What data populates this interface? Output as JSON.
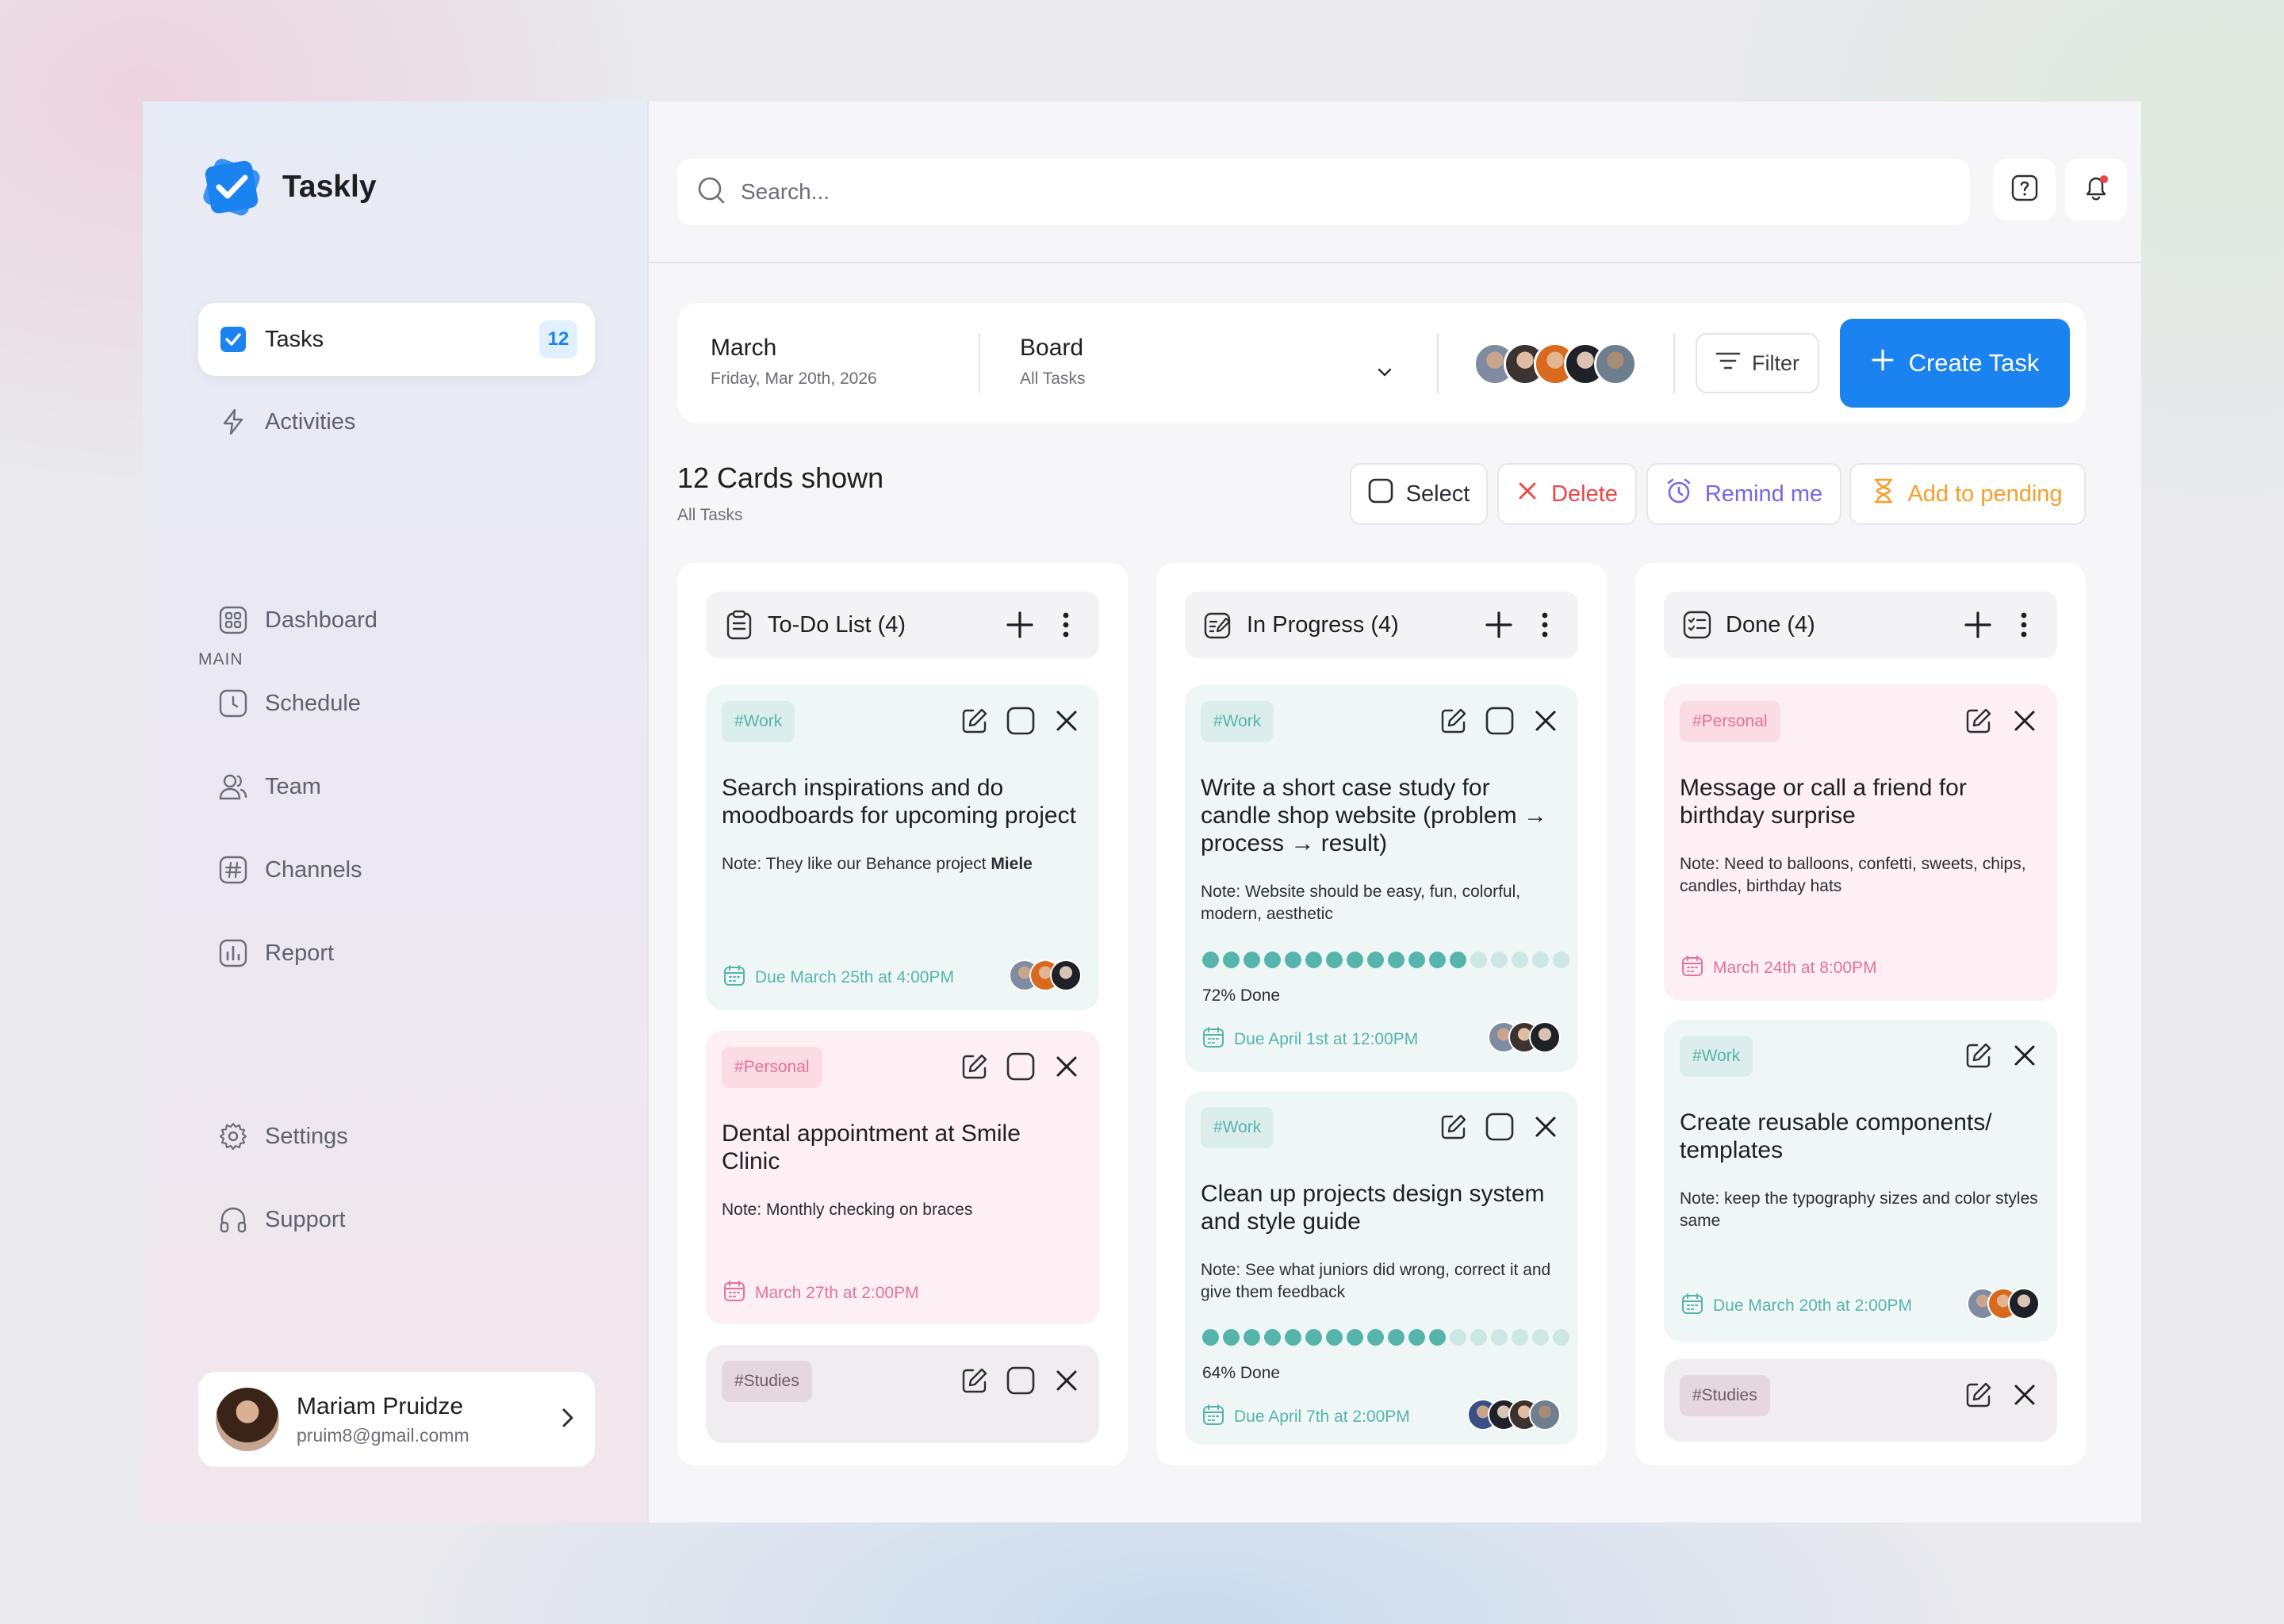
{
  "app": {
    "name": "Taskly"
  },
  "sidebar": {
    "top_items": [
      {
        "label": "Tasks",
        "badge": "12"
      },
      {
        "label": "Activities"
      }
    ],
    "section_label": "MAIN",
    "main_items": [
      {
        "label": "Dashboard"
      },
      {
        "label": "Schedule"
      },
      {
        "label": "Team"
      },
      {
        "label": "Channels"
      },
      {
        "label": "Report"
      }
    ],
    "bottom_items": [
      {
        "label": "Settings"
      },
      {
        "label": "Support"
      }
    ],
    "profile": {
      "name": "Mariam Pruidze",
      "email": "pruim8@gmail.comm"
    }
  },
  "search": {
    "placeholder": "Search..."
  },
  "toolbar": {
    "date_title": "March",
    "date_sub": "Friday, Mar 20th, 2026",
    "board_title": "Board",
    "board_sub": "All Tasks",
    "filter_label": "Filter",
    "create_label": "Create Task"
  },
  "cards_header": {
    "title": "12 Cards shown",
    "sub": "All Tasks"
  },
  "actions": {
    "select": "Select",
    "delete": "Delete",
    "remind": "Remind me",
    "pending": "Add to pending"
  },
  "colors": {
    "accent": "#1b83f0",
    "delete": "#ef4444",
    "remind": "#7467e8",
    "pending": "#f59e2a",
    "teal": "#57b4ab",
    "pink": "#e4729a"
  },
  "columns": [
    {
      "title": "To-Do List (4)",
      "cards": [
        {
          "tag": "#Work",
          "title": "Search inspirations and do moodboards for upcoming project",
          "note": "Note: They like our Behance project ",
          "note_bold": "Miele",
          "due": "Due March 25th at 4:00PM"
        },
        {
          "tag": "#Personal",
          "title": "Dental appointment at Smile Clinic",
          "note": "Note: Monthly checking on braces",
          "due": "March 27th at 2:00PM"
        },
        {
          "tag": "#Studies"
        }
      ]
    },
    {
      "title": "In Progress (4)",
      "cards": [
        {
          "tag": "#Work",
          "title": "Write a short case study for candle shop website (problem → process → result)",
          "note": "Note: Website should be easy, fun, colorful, modern, aesthetic",
          "progress": 0.72,
          "progress_label": "72% Done",
          "due": "Due April 1st at 12:00PM"
        },
        {
          "tag": "#Work",
          "title": "Clean up projects design system and style guide",
          "note": "Note: See what juniors did wrong, correct it and give them feedback",
          "progress": 0.64,
          "progress_label": "64% Done",
          "due": "Due April 7th at 2:00PM"
        }
      ]
    },
    {
      "title": "Done (4)",
      "cards": [
        {
          "tag": "#Personal",
          "title": "Message or call a friend for birthday surprise",
          "note": "Note: Need to balloons, confetti, sweets, chips, candles, birthday hats",
          "due": "March 24th at 8:00PM"
        },
        {
          "tag": "#Work",
          "title": "Create reusable components/ templates",
          "note": "Note: keep the typography sizes and color styles same",
          "due": "Due March 20th at 2:00PM"
        },
        {
          "tag": "#Studies"
        }
      ]
    }
  ]
}
